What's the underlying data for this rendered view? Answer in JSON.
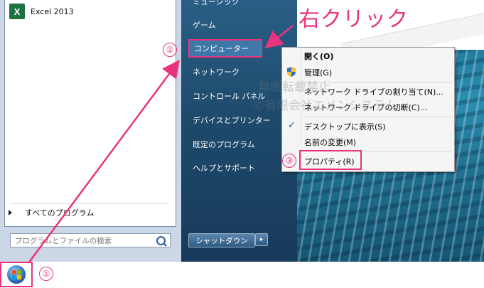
{
  "left_pane": {
    "pinned_program": "Excel 2013",
    "excel_glyph": "X",
    "all_programs": "すべてのプログラム",
    "search_placeholder": "プログラムとファイルの検索"
  },
  "right_pane": {
    "items": [
      "ミュージック",
      "ゲーム",
      "コンピューター",
      "ネットワーク",
      "コントロール パネル",
      "デバイスとプリンター",
      "既定のプログラム",
      "ヘルプとサポート"
    ],
    "shutdown_label": "シャットダウン",
    "shutdown_arrow": "▸"
  },
  "context_menu": {
    "items": [
      "開く(O)",
      "管理(G)",
      "ネットワーク ドライブの割り当て(N)...",
      "ネットワーク ドライブの切断(C)...",
      "デスクトップに表示(S)",
      "名前の変更(M)",
      "プロパティ(R)"
    ],
    "check_mark": "✓"
  },
  "annotations": {
    "right_click": "右クリック",
    "step1": "①",
    "step2": "②",
    "step3": "③"
  },
  "watermark": [
    "無断転載禁止",
    "©有限会社エメンシステム"
  ],
  "colors": {
    "accent": "#e8347c",
    "start_menu_dark": "#1e4a6c",
    "menu_bg": "#f5f5f5"
  }
}
